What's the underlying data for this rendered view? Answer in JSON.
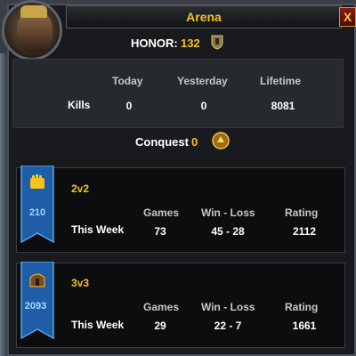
{
  "window": {
    "title": "Arena",
    "close_glyph": "X"
  },
  "honor": {
    "label": "HONOR:",
    "value": "132",
    "icon": "honor-shield-icon"
  },
  "kills_table": {
    "headers": [
      "Today",
      "Yesterday",
      "Lifetime"
    ],
    "row_label": "Kills",
    "values": [
      "0",
      "0",
      "8081"
    ]
  },
  "conquest": {
    "label": "Conquest",
    "value": "0",
    "icon": "conquest-coin-icon"
  },
  "brackets": [
    {
      "name": "2v2",
      "rating_badge": "210",
      "headers": [
        "Games",
        "Win - Loss",
        "Rating"
      ],
      "row_label": "This Week",
      "values": [
        "73",
        "45 - 28",
        "2112"
      ],
      "banner_icon": "fist-emblem-icon"
    },
    {
      "name": "3v3",
      "rating_badge": "2093",
      "headers": [
        "Games",
        "Win - Loss",
        "Rating"
      ],
      "row_label": "This Week",
      "values": [
        "29",
        "22 - 7",
        "1661"
      ],
      "banner_icon": "helmet-emblem-icon"
    }
  ],
  "colors": {
    "accent_gold": "#f6c21c",
    "banner_blue": "#1f5da8",
    "badge_text": "#9fdcff"
  }
}
